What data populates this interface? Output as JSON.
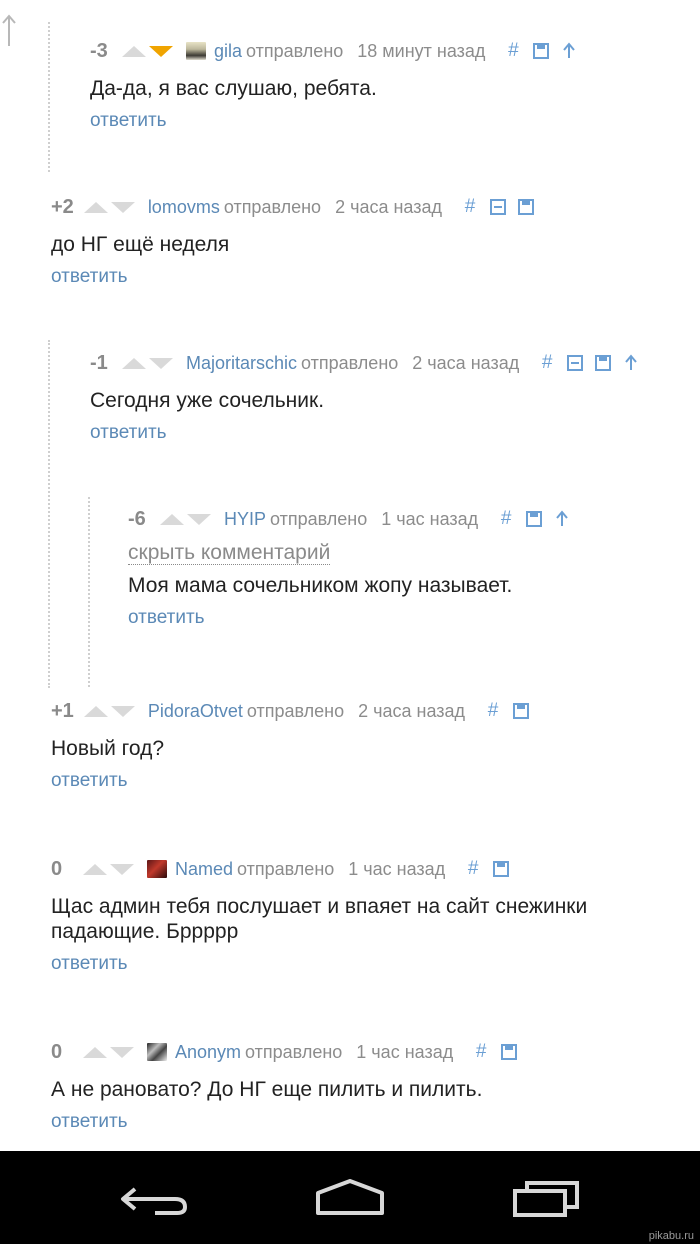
{
  "comments": [
    {
      "score": "-3",
      "user": "gila",
      "sent": "отправлено",
      "time": "18 минут назад",
      "text": "Да-да, я вас слушаю, ребята.",
      "reply": "ответить"
    },
    {
      "score": "+2",
      "user": "lomovms",
      "sent": "отправлено",
      "time": "2 часа назад",
      "text": "до НГ ещё неделя",
      "reply": "ответить"
    },
    {
      "score": "-1",
      "user": "Majoritarschic",
      "sent": "отправлено",
      "time": "2 часа назад",
      "text": "Сегодня уже сочельник.",
      "reply": "ответить"
    },
    {
      "score": "-6",
      "user": "HYIP",
      "sent": "отправлено",
      "time": "1 час назад",
      "hide": "скрыть комментарий",
      "text": "Моя мама сочельником жопу называет.",
      "reply": "ответить"
    },
    {
      "score": "+1",
      "user": "PidoraOtvet",
      "sent": "отправлено",
      "time": "2 часа назад",
      "text": "Новый год?",
      "reply": "ответить"
    },
    {
      "score": "0",
      "user": "Named",
      "sent": "отправлено",
      "time": "1 час назад",
      "text_line1": "Щас админ тебя послушает и впаяет на сайт снежинки",
      "text_line2": "падающие. Бррррр",
      "reply": "ответить"
    },
    {
      "score": "0",
      "user": "Anonym",
      "sent": "отправлено",
      "time": "1 час назад",
      "text": "А не рановато? До НГ еще пилить и пилить.",
      "reply": "ответить"
    }
  ],
  "icons": {
    "permalink": "#",
    "save": "floppy-icon",
    "parent": "arrow-up-icon",
    "collapse": "minus-box-icon"
  },
  "colors": {
    "link": "#5b89b6",
    "score": "#8a8a8a",
    "downvote_active": "#f0a400",
    "navbar": "#000000"
  },
  "watermark": "pikabu.ru"
}
